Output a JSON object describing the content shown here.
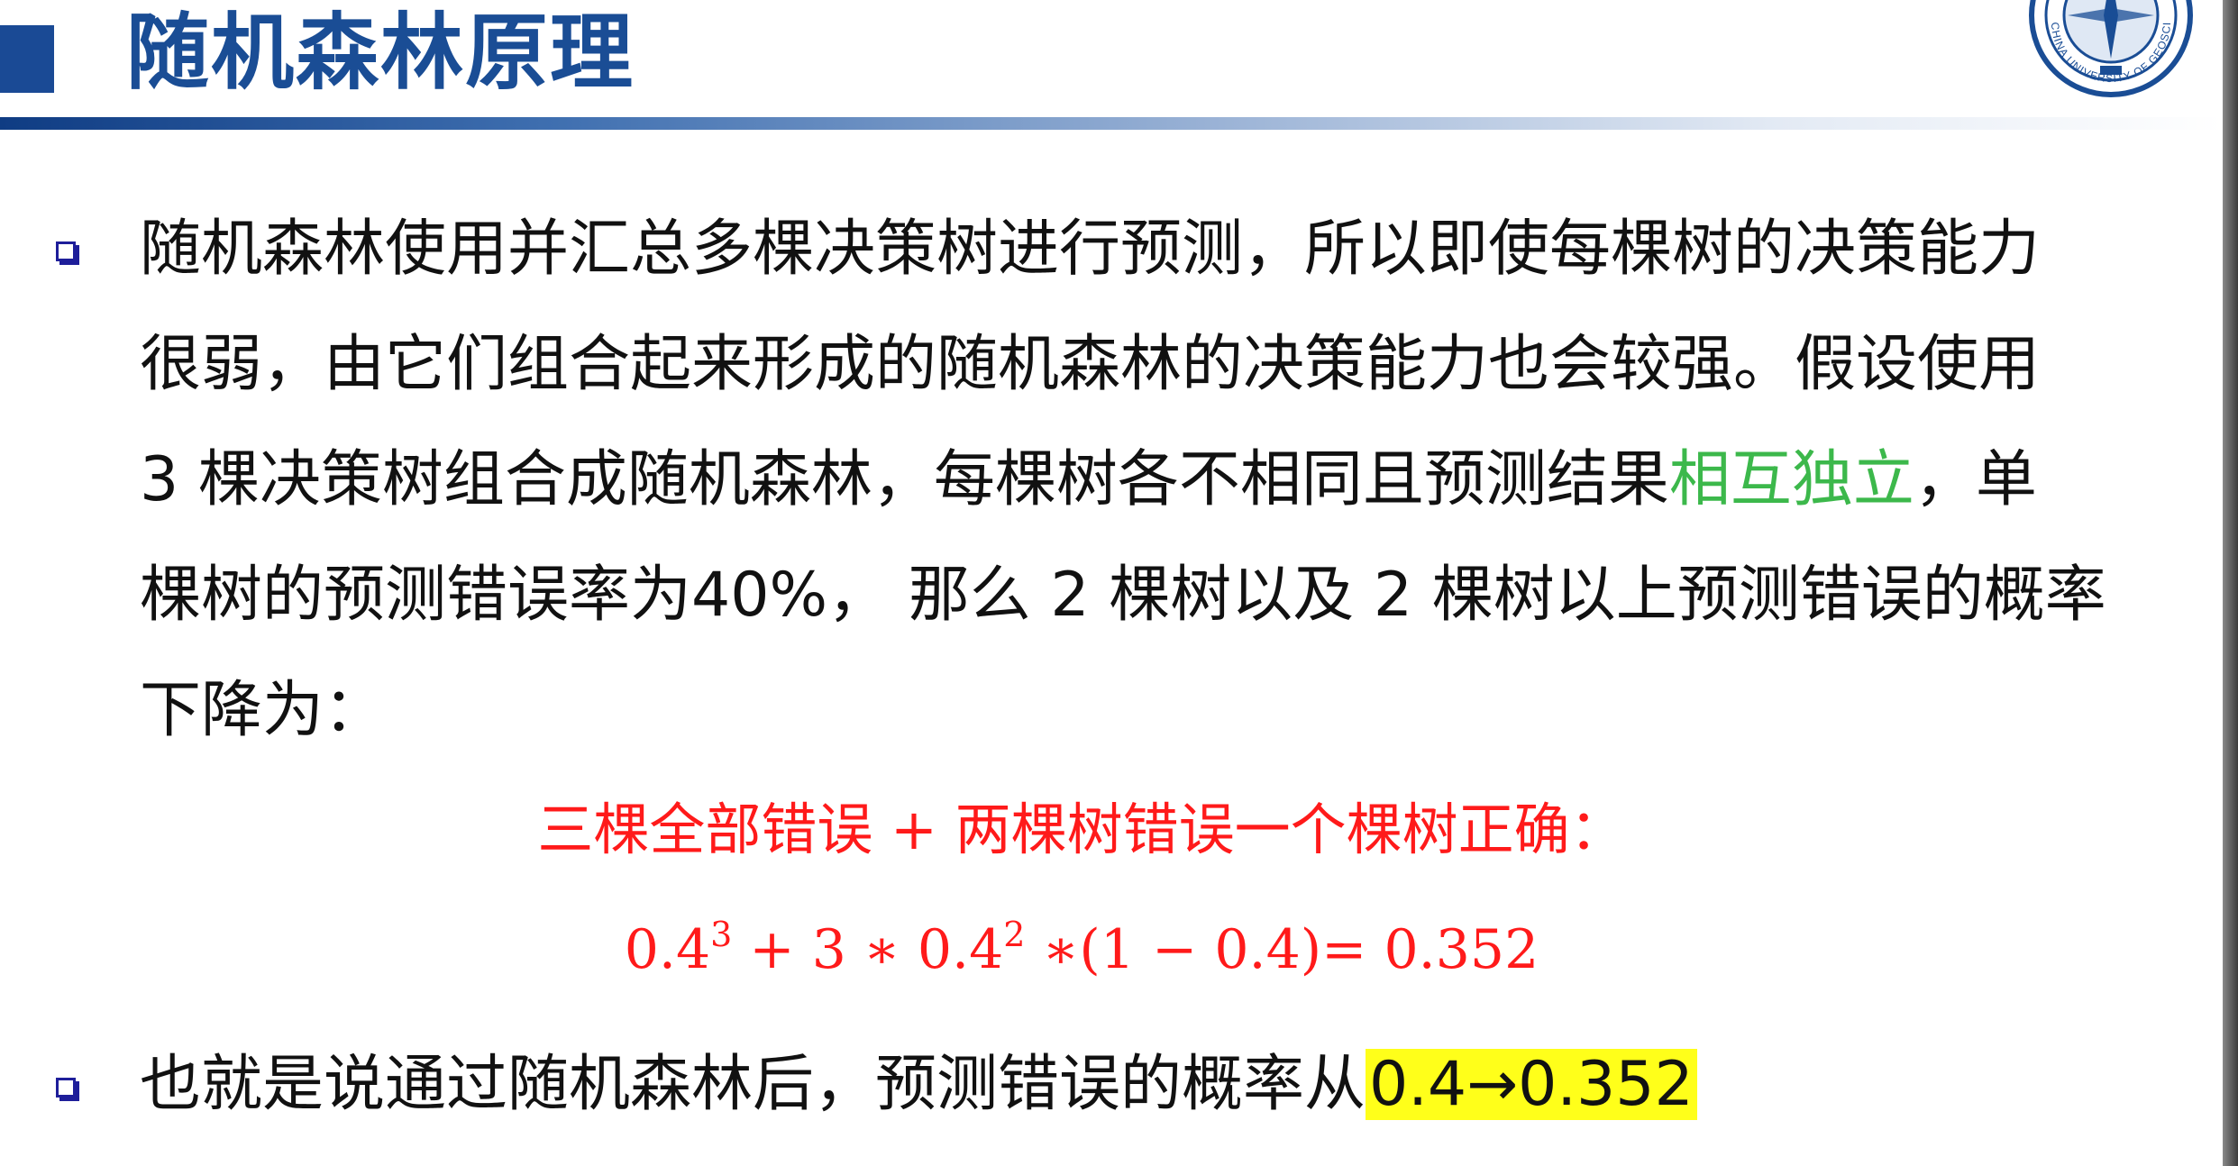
{
  "title": "随机森林原理",
  "paragraph1": {
    "line1": [
      "随机森林使用并汇总多棵决策树进行预测，所以即使每棵树的决策能力"
    ],
    "line2": [
      "很弱，由它们组合起来形成的随机森林的决策能力也会较强。假设使用"
    ],
    "line3_pre": "3 棵决策树组合成随机森林，每棵树各不相同且预测结果",
    "line3_highlight": "相互独立",
    "line3_post": "，单",
    "line4": "棵树的预测错误率为40%， 那么 2 棵树以及 2 棵树以上预测错误的概率",
    "line5": "下降为："
  },
  "formula_label": "三棵全部错误 + 两棵树错误一个棵树正确：",
  "formula": {
    "base1": "0.4",
    "exp1": "3",
    "mid": " + 3 ∗ 0.4",
    "exp2": "2",
    "end": " ∗(1 − 0.4)= 0.352"
  },
  "paragraph2": {
    "text": "也就是说通过随机森林后，预测错误的概率从",
    "highlight": "0.4→0.352"
  },
  "colors": {
    "title": "#1a4d95",
    "accent_green": "#3cb84b",
    "formula_red": "#ff1a1a",
    "highlight_yellow": "#ffff1a",
    "bullet_blue": "#1e1e9a"
  },
  "logo": {
    "icon": "university-seal-icon",
    "text": "CHINA UNIVERSITY OF GEOSCIENCES"
  }
}
